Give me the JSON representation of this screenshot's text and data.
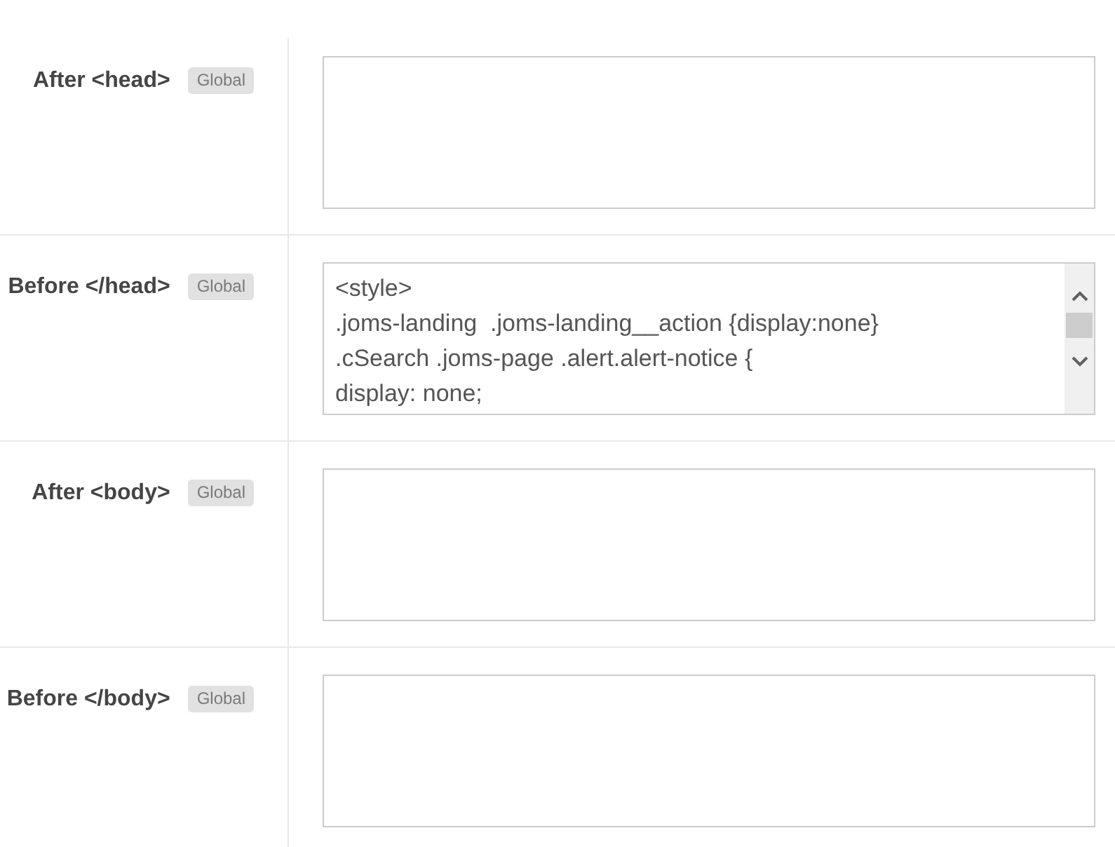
{
  "rows": [
    {
      "label": "After <head>",
      "badge": "Global",
      "field": {
        "scrollbar": false
      }
    },
    {
      "label": "Before </head>",
      "badge": "Global",
      "field": {
        "value": "<style>\n.joms-landing  .joms-landing__action {display:none}\n.cSearch .joms-page .alert.alert-notice {\ndisplay: none;",
        "scrollbar": true
      }
    },
    {
      "label": "After <body>",
      "badge": "Global",
      "field": {
        "scrollbar": false
      }
    },
    {
      "label": "Before </body>",
      "badge": "Global",
      "field": {
        "scrollbar": false
      }
    }
  ]
}
